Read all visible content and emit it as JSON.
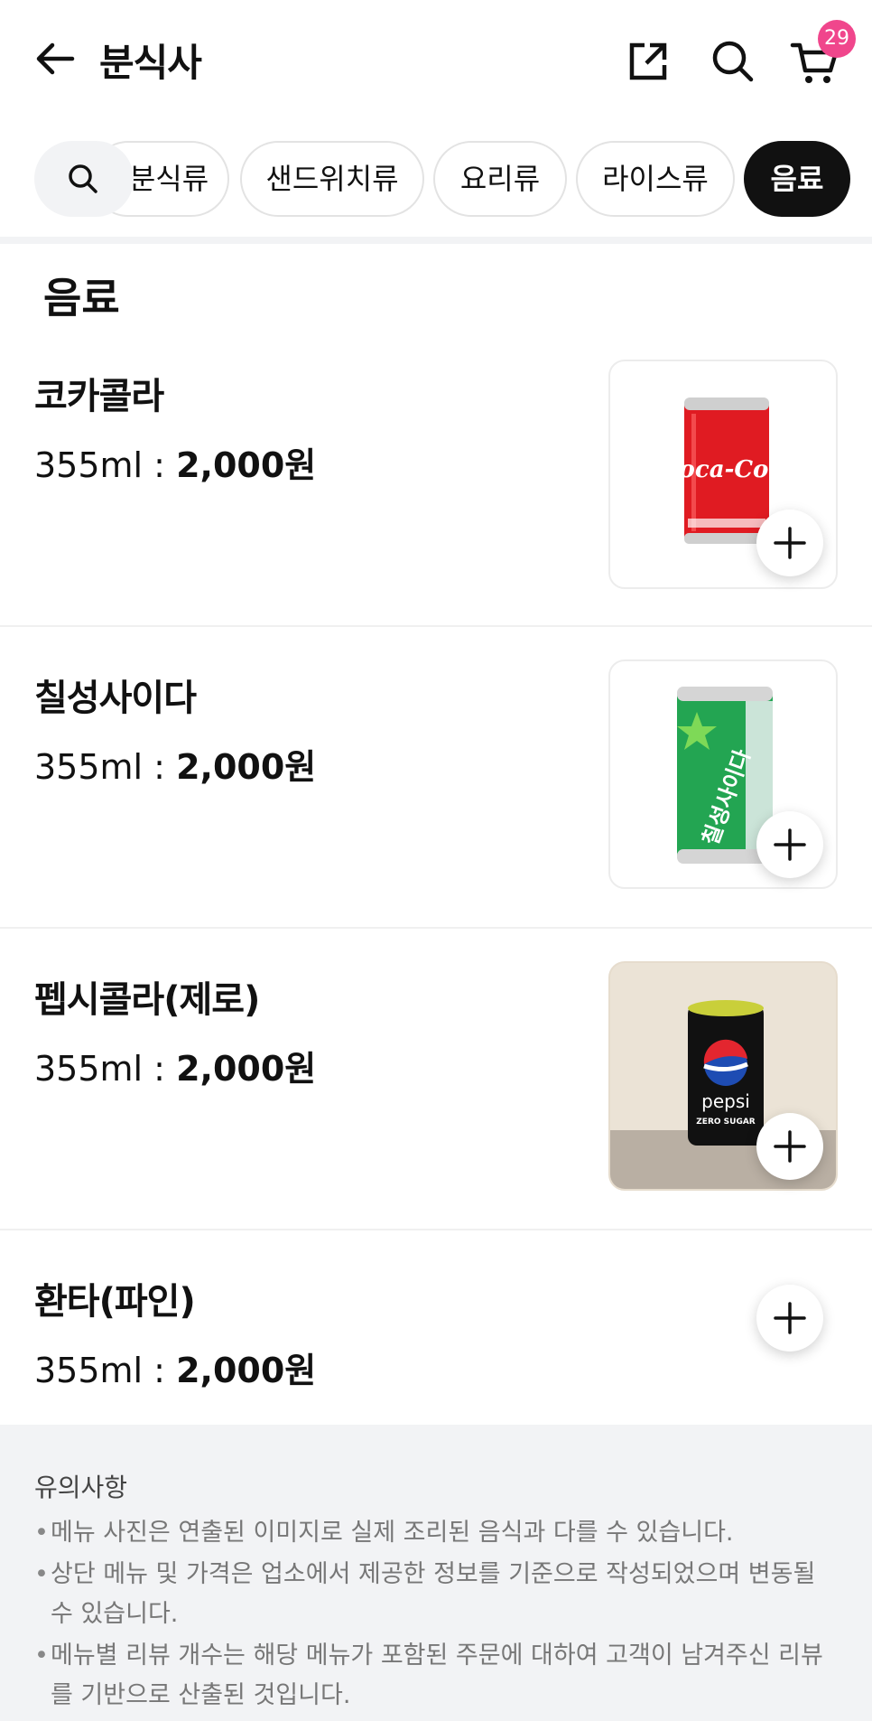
{
  "header": {
    "title": "분식사",
    "cart_count": "29"
  },
  "categories": [
    {
      "label": "분식류",
      "active": false
    },
    {
      "label": "샌드위치류",
      "active": false
    },
    {
      "label": "요리류",
      "active": false
    },
    {
      "label": "라이스류",
      "active": false
    },
    {
      "label": "음료",
      "active": true
    }
  ],
  "section": {
    "title": "음료"
  },
  "menu_items": [
    {
      "name": "코카콜라",
      "size": "355ml : ",
      "price": "2,000원",
      "has_image": true,
      "image": "coca-cola-can"
    },
    {
      "name": "칠성사이다",
      "size": "355ml : ",
      "price": "2,000원",
      "has_image": true,
      "image": "chilsung-cider-can"
    },
    {
      "name": "펩시콜라(제로)",
      "size": "355ml : ",
      "price": "2,000원",
      "has_image": true,
      "image": "pepsi-zero-can"
    },
    {
      "name": "환타(파인)",
      "size": "355ml : ",
      "price": "2,000원",
      "has_image": false
    }
  ],
  "can_labels": {
    "coca": "Coca-Cola",
    "cider": "칠성사이다",
    "pepsi": "pepsi",
    "pepsi_sub": "ZERO SUGAR"
  },
  "notice": {
    "title": "유의사항",
    "items": [
      "메뉴 사진은 연출된 이미지로 실제 조리된 음식과 다를 수 있습니다.",
      "상단 메뉴 및 가격은 업소에서 제공한 정보를 기준으로 작성되었으며 변동될 수 있습니다.",
      "메뉴별 리뷰 개수는 해당 메뉴가 포함된 주문에 대하여 고객이 남겨주신 리뷰를 기반으로 산출된 것입니다."
    ]
  },
  "colors": {
    "badge": "#f0468c",
    "active_chip": "#111111",
    "notice_bg": "#f2f3f5"
  }
}
